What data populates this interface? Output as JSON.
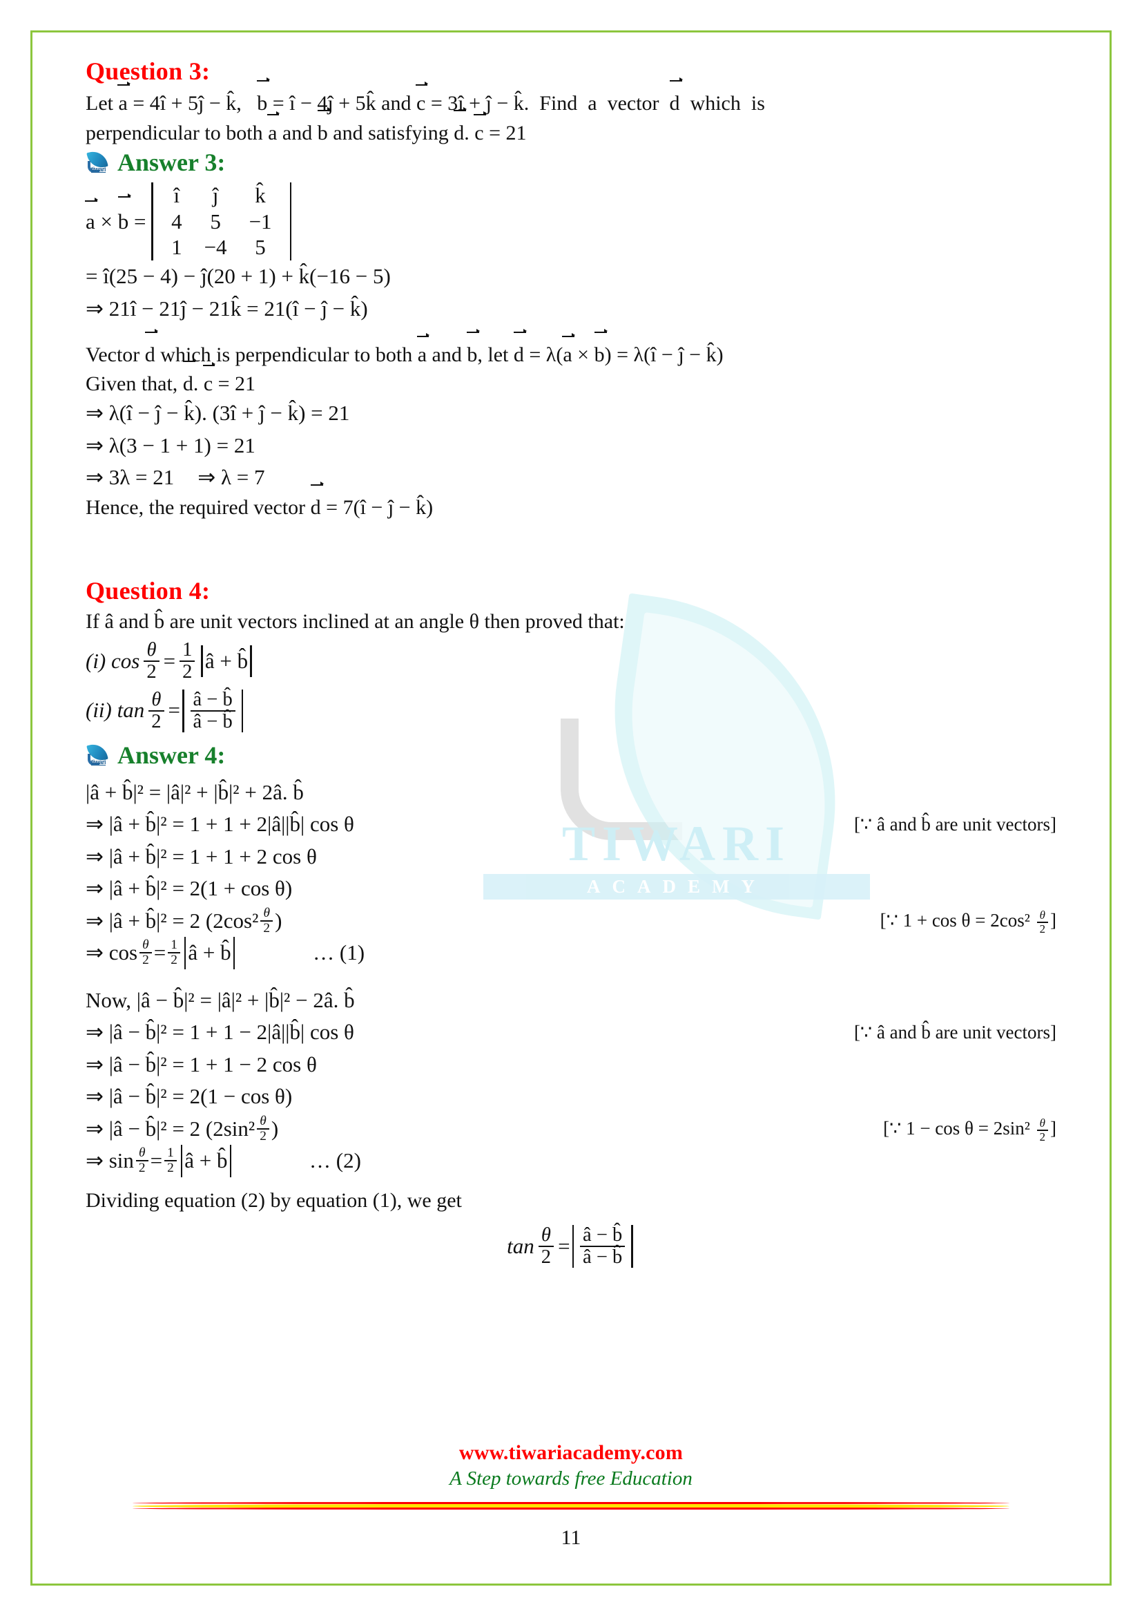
{
  "page": {
    "number": "11",
    "border_color": "#8cc63e"
  },
  "watermark": {
    "brand": "TIWARI",
    "sub": "ACADEMY",
    "leaf_color": "#ccf0f4"
  },
  "logo": {
    "text": "tiwari"
  },
  "q3": {
    "heading": "Question 3:",
    "statement_1": "Let a⃗ = 4î + 5ĵ − k̂,   b⃗ = î − 4ĵ + 5k̂ and c⃗ = 3î + ĵ − k̂.   Find a vector d⃗ which is",
    "statement_2": "perpendicular to both a⃗ and b⃗ and satisfying d⃗. c⃗ = 21",
    "answer_heading": "Answer 3:",
    "det_label": "a⃗ × b⃗ =",
    "det_rows": [
      [
        "î",
        "ĵ",
        "k̂"
      ],
      [
        "4",
        "5",
        "−1"
      ],
      [
        "1",
        "−4",
        "5"
      ]
    ],
    "line_expand": "= î(25 − 4) − ĵ(20 + 1) + k̂(−16 − 5)",
    "line_result": "⇒ 21î − 21ĵ − 21k̂ = 21(î − ĵ − k̂)",
    "line_vecd": "Vector d⃗ which is perpendicular to both a⃗ and b⃗, let d⃗ = λ(a⃗ × b⃗) = λ(î − ĵ − k̂)",
    "line_given": "Given that, d⃗. c⃗ = 21",
    "line_dot": "⇒ λ(î − ĵ − k̂). (3î + ĵ − k̂) = 21",
    "line_simpl": "⇒ λ(3 − 1 + 1) = 21",
    "line_lambda_a": "⇒ 3λ = 21",
    "line_lambda_b": "⇒ λ = 7",
    "line_hence": "Hence, the required vector d⃗ = 7(î − ĵ − k̂)"
  },
  "q4": {
    "heading": "Question 4:",
    "statement": "If â and b̂ are unit vectors inclined at an angle θ then proved that:",
    "part_i_label": "(i) cos",
    "part_i_rhs_num": "1",
    "part_i_rhs_den": "2",
    "part_i_abs": "â + b̂",
    "part_ii_label": "(ii) tan",
    "part_ii_num": "â − b̂",
    "part_ii_den": "â − b̂",
    "theta": "θ",
    "two": "2",
    "answer_heading": "Answer 4:",
    "note_unit": "[∵ â and b̂ are unit vectors]",
    "note_cos": "[∵ 1 + cos θ = 2cos²",
    "note_sin": "[∵ 1 − cos θ = 2sin²",
    "eq1_tag": "… (1)",
    "eq2_tag": "… (2)",
    "lines_plus": [
      {
        "lhs": "|â + b̂|²",
        "rhs": "= |â|² + |b̂|² + 2â. b̂",
        "note": ""
      },
      {
        "lhs": "⇒ |â + b̂|²",
        "rhs": "= 1 + 1 + 2|â||b̂| cos θ",
        "note": "[∵ â and b̂ are unit vectors]"
      },
      {
        "lhs": "⇒ |â + b̂|²",
        "rhs": "= 1 + 1 + 2 cos θ",
        "note": ""
      },
      {
        "lhs": "⇒ |â + b̂|²",
        "rhs": "= 2(1 + cos θ)",
        "note": ""
      }
    ],
    "lines_minus_intro": "Now, |â − b̂|² = |â|² + |b̂|² − 2â. b̂",
    "lines_minus": [
      {
        "lhs": "⇒ |â − b̂|²",
        "rhs": "= 1 + 1 − 2|â||b̂| cos θ",
        "note": "[∵ â and b̂ are unit vectors]"
      },
      {
        "lhs": "⇒ |â − b̂|²",
        "rhs": "= 1 + 1 − 2 cos θ",
        "note": ""
      },
      {
        "lhs": "⇒ |â − b̂|²",
        "rhs": "= 2(1 − cos θ)",
        "note": ""
      }
    ],
    "cos_half_line_lead": "⇒ cos",
    "sin_half_line_lead": "⇒ sin",
    "half_rhs_num": "1",
    "half_rhs_den": "2",
    "cos_half_abs": "â + b̂",
    "sin_half_abs": "â + b̂",
    "two_paren_open": "= 2 (2cos²",
    "two_paren_open_sin": "= 2 (2sin²",
    "paren_close": ")",
    "dividing": "Dividing equation (2) by equation (1), we get",
    "final_lead": "tan",
    "final_num": "â − b̂",
    "final_den": "â − b̂"
  },
  "footer": {
    "url": "www.tiwariacademy.com",
    "tagline": "A Step towards free Education",
    "url_color": "#ff0000",
    "tagline_color": "#0a7a1e"
  }
}
